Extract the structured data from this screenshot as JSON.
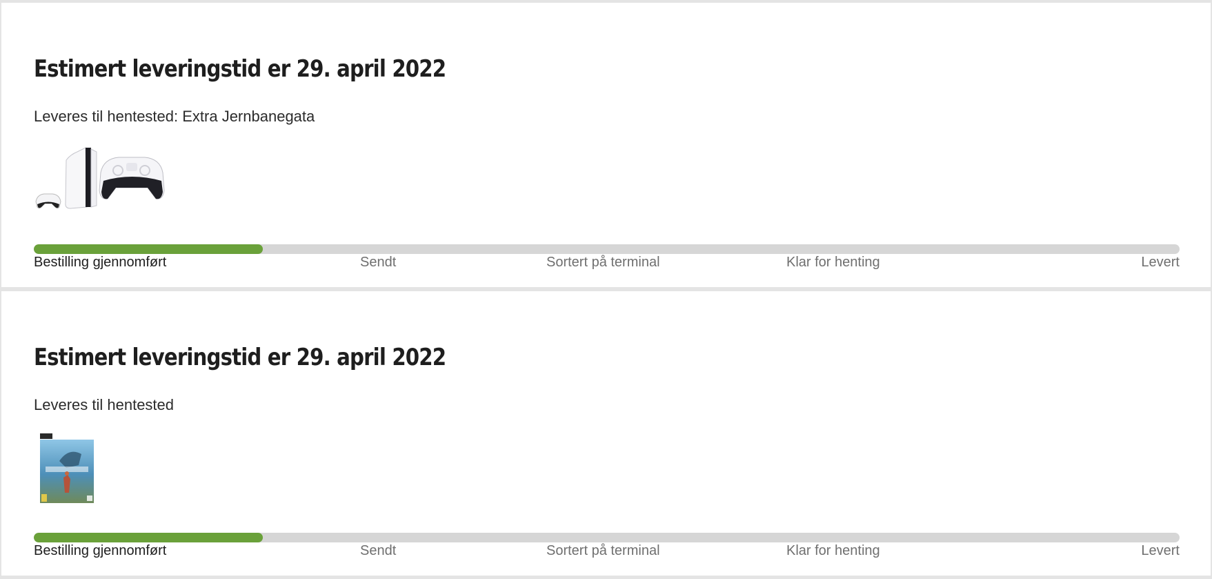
{
  "accent_color": "#6aa13a",
  "orders": [
    {
      "title": "Estimert leveringstid er 29. april 2022",
      "delivery_text": "Leveres til hentested: Extra Jernbanegata",
      "product_image": "ps5-console-with-controllers",
      "progress_fraction": 0.2,
      "steps": [
        {
          "label": "Bestilling gjennomført",
          "active": true
        },
        {
          "label": "Sendt",
          "active": false
        },
        {
          "label": "Sortert på terminal",
          "active": false
        },
        {
          "label": "Klar for henting",
          "active": false
        },
        {
          "label": "Levert",
          "active": false
        }
      ]
    },
    {
      "title": "Estimert leveringstid er 29. april 2022",
      "delivery_text": "Leveres til hentested",
      "product_image": "horizon-game-cover",
      "progress_fraction": 0.2,
      "steps": [
        {
          "label": "Bestilling gjennomført",
          "active": true
        },
        {
          "label": "Sendt",
          "active": false
        },
        {
          "label": "Sortert på terminal",
          "active": false
        },
        {
          "label": "Klar for henting",
          "active": false
        },
        {
          "label": "Levert",
          "active": false
        }
      ]
    }
  ]
}
